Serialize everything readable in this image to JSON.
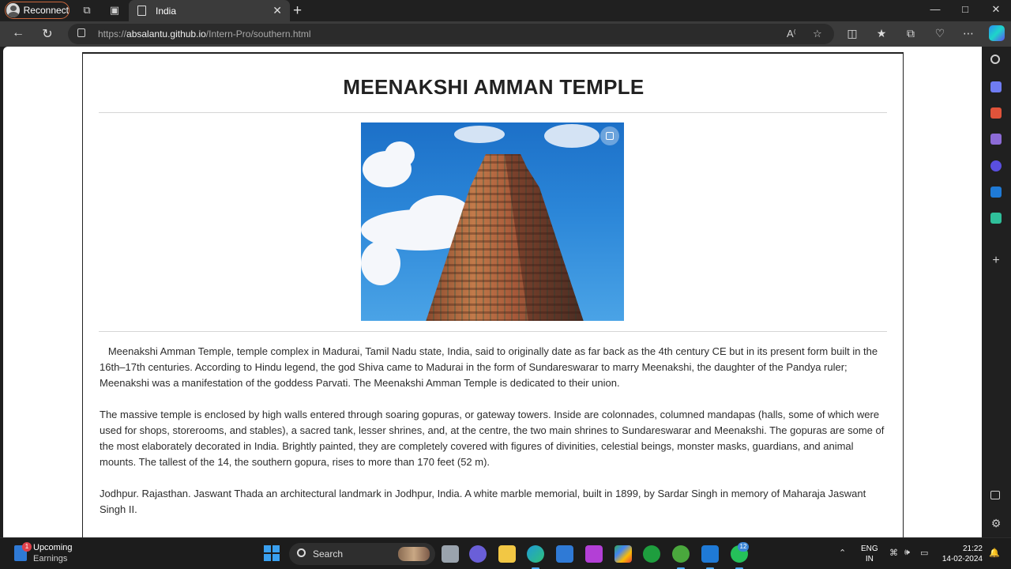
{
  "browser": {
    "profile_button": "Reconnect",
    "tab_title": "India",
    "url_domain": "absalantu.github.io",
    "url_prefix": "https://",
    "url_path": "/Intern-Pro/southern.html"
  },
  "page": {
    "heading": "MEENAKSHI AMMAN TEMPLE",
    "paragraphs": [
      "   Meenakshi Amman Temple, temple complex in Madurai, Tamil Nadu state, India, said to originally date as far back as the 4th century CE but in its present form built in the 16th–17th centuries. According to Hindu legend, the god Shiva came to Madurai in the form of Sundareswarar to marry Meenakshi, the daughter of the Pandya ruler; Meenakshi was a manifestation of the goddess Parvati. The Meenakshi Amman Temple is dedicated to their union.",
      "The massive temple is enclosed by high walls entered through soaring gopuras, or gateway towers. Inside are colonnades, columned mandapas (halls, some of which were used for shops, storerooms, and stables), a sacred tank, lesser shrines, and, at the centre, the two main shrines to Sundareswarar and Meenakshi. The gopuras are some of the most elaborately decorated in India. Brightly painted, they are completely covered with figures of divinities, celestial beings, monster masks, guardians, and animal mounts. The tallest of the 14, the southern gopura, rises to more than 170 feet (52 m).",
      "Jodhpur. Rajasthan. Jaswant Thada an architectural landmark in Jodhpur, India. A white marble memorial, built in 1899, by Sardar Singh in memory of Maharaja Jaswant Singh II."
    ]
  },
  "taskbar": {
    "weather_title": "Upcoming",
    "weather_sub": "Earnings",
    "weather_badge": "1",
    "search_label": "Search",
    "whatsapp_badge": "12",
    "lang_1": "ENG",
    "lang_2": "IN",
    "time": "21:22",
    "date": "14-02-2024"
  }
}
